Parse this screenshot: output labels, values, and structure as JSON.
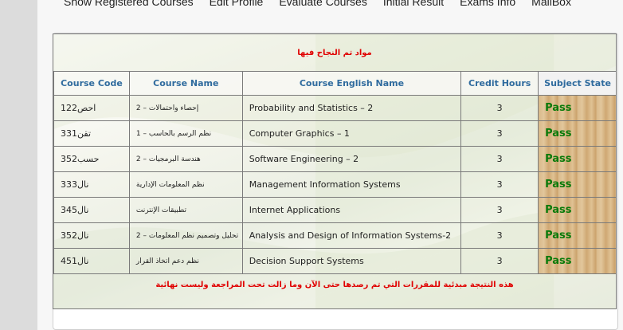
{
  "nav": {
    "items": [
      "Show Registered Courses",
      "Edit Profile",
      "Evaluate Courses",
      "Initial Result",
      "Exams Info",
      "MailBox"
    ]
  },
  "results": {
    "banner": "مواد تم النجاح فيها",
    "headers": {
      "code": "Course Code",
      "name": "Course Name",
      "english": "Course English Name",
      "hours": "Credit Hours",
      "state": "Subject State"
    },
    "rows": [
      {
        "code": "احص122",
        "name": "إحصاء واحتمالات – 2",
        "english": "Probability and Statistics – 2",
        "hours": "3",
        "state": "Pass"
      },
      {
        "code": "تقن331",
        "name": "نظم الرسم بالحاسب – 1",
        "english": "Computer Graphics – 1",
        "hours": "3",
        "state": "Pass"
      },
      {
        "code": "حسب352",
        "name": "هندسة البرمجيات – 2",
        "english": "Software Engineering – 2",
        "hours": "3",
        "state": "Pass"
      },
      {
        "code": "نال333",
        "name": "نظم المعلومات الإدارية",
        "english": "Management Information Systems",
        "hours": "3",
        "state": "Pass"
      },
      {
        "code": "نال345",
        "name": "تطبيقات الإنترنت",
        "english": "Internet Applications",
        "hours": "3",
        "state": "Pass"
      },
      {
        "code": "نال352",
        "name": "تحليل وتصميم نظم المعلومات – 2",
        "english": "Analysis and Design of Information Systems-2",
        "hours": "3",
        "state": "Pass"
      },
      {
        "code": "نال451",
        "name": "نظم دعم اتخاذ القرار",
        "english": "Decision Support Systems",
        "hours": "3",
        "state": "Pass"
      }
    ],
    "footer": "هذه النتيجة مبدئية للمقررات التي تم رصدها حتى الآن وما زالت تحت المراجعة وليست نهائية"
  },
  "colors": {
    "header_text": "#2f6b9e",
    "pass_text": "#0a7a0a",
    "notice_text": "#e00000"
  }
}
